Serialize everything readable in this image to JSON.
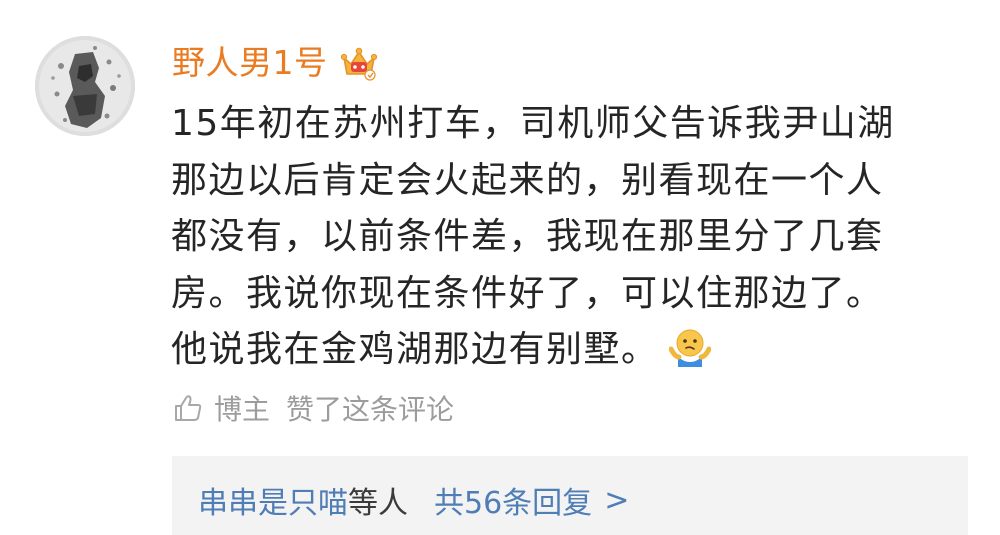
{
  "comment": {
    "username": "野人男1号",
    "badge_icon": "vip-crown-icon",
    "lines": [
      "15年初在苏州打车，司机师父告诉我尹山湖",
      "那边以后肯定会火起来的，别看现在一个人",
      "都没有，以前条件差，我现在那里分了几套",
      "房。我说你现在条件好了，可以住那边了。",
      "他说我在金鸡湖那边有别墅。"
    ],
    "trailing_emoji": "shrug-emoji-icon"
  },
  "like": {
    "icon": "thumbs-up-icon",
    "author": "博主",
    "text": "赞了这条评论"
  },
  "replies": {
    "user": "串串是只喵",
    "suffix": "等人",
    "count_label": "共56条回复",
    "chevron": ">"
  },
  "colors": {
    "username": "#ea7b20",
    "body_text": "#252525",
    "muted": "#9c9c9c",
    "link": "#4f7db5",
    "reply_bg": "#f3f3f3"
  }
}
